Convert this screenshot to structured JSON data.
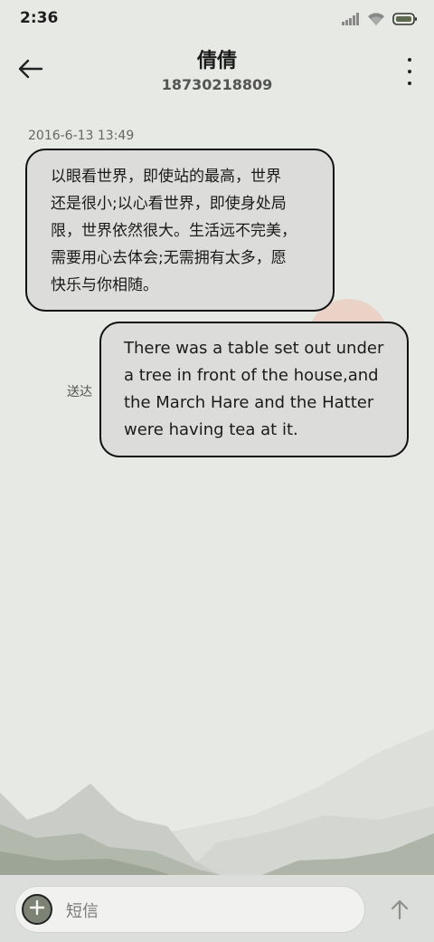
{
  "status_bar": {
    "time": "2:36",
    "icons": [
      "signal-icon",
      "wifi-icon",
      "battery-icon"
    ]
  },
  "header": {
    "back_icon": "arrow-left-icon",
    "contact_name": "倩倩",
    "contact_number": "18730218809",
    "menu_icon": "more-vertical-icon"
  },
  "conversation": {
    "timestamp": "2016-6-13 13:49",
    "messages": [
      {
        "direction": "incoming",
        "text": "以眼看世界，即使站的最高，世界\n还是很小;以心看世界，即使身处局\n限，世界依然很大。生活远不完美，\n需要用心去体会;无需拥有太多，愿\n快乐与你相随。"
      },
      {
        "direction": "outgoing",
        "text": "There was a table set out under\na tree in front of the house,and\nthe March Hare and the Hatter\nwere having tea at it.",
        "status": "送达"
      }
    ]
  },
  "composer": {
    "add_icon": "plus-icon",
    "placeholder": "短信",
    "send_icon": "arrow-up-icon"
  },
  "colors": {
    "background": "#e6e9e4",
    "bubble_fill": "#dcdcda",
    "bubble_border": "#111111",
    "accent_plus": "#7c8274",
    "sun": "#ead3c6"
  }
}
